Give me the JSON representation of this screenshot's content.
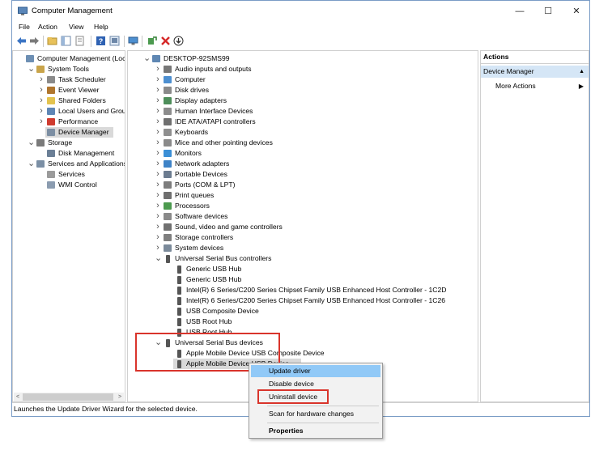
{
  "window": {
    "title": "Computer Management",
    "controls": {
      "minimize": "—",
      "maximize": "☐",
      "close": "✕"
    }
  },
  "menu": [
    "File",
    "Action",
    "View",
    "Help"
  ],
  "toolbar_icons": [
    "back-arrow-icon",
    "forward-arrow-icon",
    "up-folder-icon",
    "show-hide-tree-icon",
    "properties-icon",
    "help-icon",
    "console-icon",
    "monitor-icon",
    "scan-hardware-icon",
    "uninstall-x-icon",
    "update-driver-icon"
  ],
  "left_tree": [
    {
      "label": "Computer Management (Local",
      "level": 0,
      "expand": "",
      "icon": "computer-management-icon",
      "color": "#6d8fb3"
    },
    {
      "label": "System Tools",
      "level": 1,
      "expand": "v",
      "icon": "tools-icon",
      "color": "#c9a44a"
    },
    {
      "label": "Task Scheduler",
      "level": 2,
      "expand": ">",
      "icon": "clock-icon",
      "color": "#8a8a8a"
    },
    {
      "label": "Event Viewer",
      "level": 2,
      "expand": ">",
      "icon": "event-viewer-icon",
      "color": "#b0762e"
    },
    {
      "label": "Shared Folders",
      "level": 2,
      "expand": ">",
      "icon": "shared-folder-icon",
      "color": "#e3c34f"
    },
    {
      "label": "Local Users and Groups",
      "level": 2,
      "expand": ">",
      "icon": "users-icon",
      "color": "#5e86b5"
    },
    {
      "label": "Performance",
      "level": 2,
      "expand": ">",
      "icon": "performance-icon",
      "color": "#cf3b2f"
    },
    {
      "label": "Device Manager",
      "level": 2,
      "expand": "",
      "icon": "device-manager-icon",
      "color": "#7c8ea3",
      "selected": true
    },
    {
      "label": "Storage",
      "level": 1,
      "expand": "v",
      "icon": "storage-icon",
      "color": "#7a7a7a"
    },
    {
      "label": "Disk Management",
      "level": 2,
      "expand": "",
      "icon": "disk-icon",
      "color": "#6b7f96"
    },
    {
      "label": "Services and Applications",
      "level": 1,
      "expand": "v",
      "icon": "services-app-icon",
      "color": "#7b8fa5"
    },
    {
      "label": "Services",
      "level": 2,
      "expand": "",
      "icon": "services-gear-icon",
      "color": "#9b9b9b"
    },
    {
      "label": "WMI Control",
      "level": 2,
      "expand": "",
      "icon": "wmi-icon",
      "color": "#8b9cb0"
    }
  ],
  "device_tree": [
    {
      "label": "DESKTOP-92SMS99",
      "level": 0,
      "expand": "v",
      "icon": "computer-icon",
      "color": "#5f87b3"
    },
    {
      "label": "Audio inputs and outputs",
      "level": 1,
      "expand": ">",
      "icon": "speaker-icon",
      "color": "#777777"
    },
    {
      "label": "Computer",
      "level": 1,
      "expand": ">",
      "icon": "computer-icon",
      "color": "#4d8fd0"
    },
    {
      "label": "Disk drives",
      "level": 1,
      "expand": ">",
      "icon": "disk-drive-icon",
      "color": "#8a8a8a"
    },
    {
      "label": "Display adapters",
      "level": 1,
      "expand": ">",
      "icon": "display-adapter-icon",
      "color": "#4e8e5a"
    },
    {
      "label": "Human Interface Devices",
      "level": 1,
      "expand": ">",
      "icon": "hid-icon",
      "color": "#8c8c8c"
    },
    {
      "label": "IDE ATA/ATAPI controllers",
      "level": 1,
      "expand": ">",
      "icon": "ide-controller-icon",
      "color": "#6f6f6f"
    },
    {
      "label": "Keyboards",
      "level": 1,
      "expand": ">",
      "icon": "keyboard-icon",
      "color": "#8f8f8f"
    },
    {
      "label": "Mice and other pointing devices",
      "level": 1,
      "expand": ">",
      "icon": "mouse-icon",
      "color": "#8a8a8a"
    },
    {
      "label": "Monitors",
      "level": 1,
      "expand": ">",
      "icon": "monitor-icon",
      "color": "#3b8fd6"
    },
    {
      "label": "Network adapters",
      "level": 1,
      "expand": ">",
      "icon": "network-adapter-icon",
      "color": "#3e83c7"
    },
    {
      "label": "Portable Devices",
      "level": 1,
      "expand": ">",
      "icon": "portable-device-icon",
      "color": "#6c7c90"
    },
    {
      "label": "Ports (COM & LPT)",
      "level": 1,
      "expand": ">",
      "icon": "port-icon",
      "color": "#7d7d7d"
    },
    {
      "label": "Print queues",
      "level": 1,
      "expand": ">",
      "icon": "printer-icon",
      "color": "#6f6f6f"
    },
    {
      "label": "Processors",
      "level": 1,
      "expand": ">",
      "icon": "processor-icon",
      "color": "#4c9a4f"
    },
    {
      "label": "Software devices",
      "level": 1,
      "expand": ">",
      "icon": "software-device-icon",
      "color": "#8a8a8a"
    },
    {
      "label": "Sound, video and game controllers",
      "level": 1,
      "expand": ">",
      "icon": "sound-icon",
      "color": "#707070"
    },
    {
      "label": "Storage controllers",
      "level": 1,
      "expand": ">",
      "icon": "storage-controller-icon",
      "color": "#7f7f7f"
    },
    {
      "label": "System devices",
      "level": 1,
      "expand": ">",
      "icon": "system-device-icon",
      "color": "#7b8a9a"
    },
    {
      "label": "Universal Serial Bus controllers",
      "level": 1,
      "expand": "v",
      "icon": "usb-icon",
      "color": "#555555"
    },
    {
      "label": "Generic USB Hub",
      "level": 2,
      "expand": "",
      "icon": "usb-icon",
      "color": "#555555"
    },
    {
      "label": "Generic USB Hub",
      "level": 2,
      "expand": "",
      "icon": "usb-icon",
      "color": "#555555"
    },
    {
      "label": "Intel(R) 6 Series/C200 Series Chipset Family USB Enhanced Host Controller - 1C2D",
      "level": 2,
      "expand": "",
      "icon": "usb-icon",
      "color": "#555555"
    },
    {
      "label": "Intel(R) 6 Series/C200 Series Chipset Family USB Enhanced Host Controller - 1C26",
      "level": 2,
      "expand": "",
      "icon": "usb-icon",
      "color": "#555555"
    },
    {
      "label": "USB Composite Device",
      "level": 2,
      "expand": "",
      "icon": "usb-icon",
      "color": "#555555"
    },
    {
      "label": "USB Root Hub",
      "level": 2,
      "expand": "",
      "icon": "usb-icon",
      "color": "#555555"
    },
    {
      "label": "USB Root Hub",
      "level": 2,
      "expand": "",
      "icon": "usb-icon",
      "color": "#555555"
    },
    {
      "label": "Universal Serial Bus devices",
      "level": 1,
      "expand": "v",
      "icon": "usb-icon",
      "color": "#555555"
    },
    {
      "label": "Apple Mobile Device USB Composite Device",
      "level": 2,
      "expand": "",
      "icon": "usb-icon",
      "color": "#555555"
    },
    {
      "label": "Apple Mobile Device USB Device",
      "level": 2,
      "expand": "",
      "icon": "usb-icon",
      "color": "#555555",
      "selected": true
    }
  ],
  "actions": {
    "header": "Actions",
    "section": "Device Manager",
    "more": "More Actions"
  },
  "context_menu": {
    "update": "Update driver",
    "disable": "Disable device",
    "uninstall": "Uninstall device",
    "scan": "Scan for hardware changes",
    "properties": "Properties"
  },
  "status": "Launches the Update Driver Wizard for the selected device.",
  "colors": {
    "highlight_box": "#d9342b",
    "menu_highlight": "#91c9f7",
    "actions_section": "#d5e6f6"
  }
}
